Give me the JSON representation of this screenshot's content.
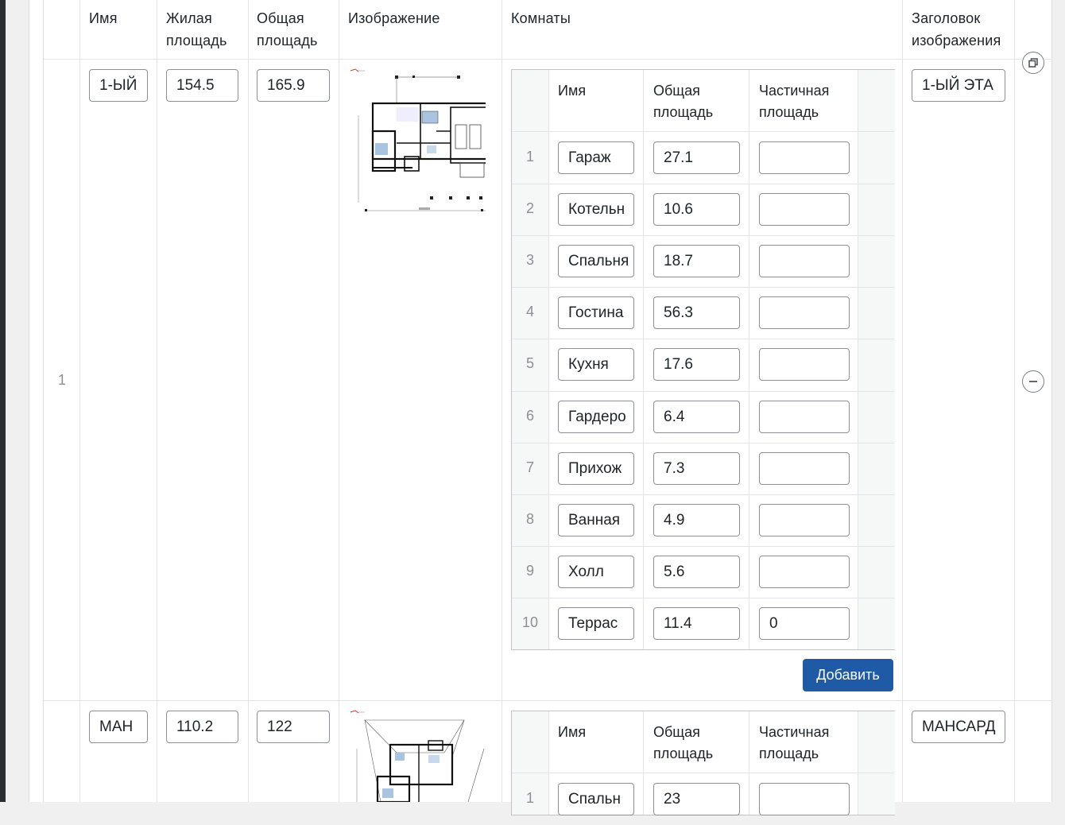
{
  "columns": {
    "name": "Имя",
    "living_area": [
      "Жилая",
      "площадь"
    ],
    "total_area": [
      "Общая",
      "площадь"
    ],
    "image": "Изображение",
    "rooms": "Комнаты",
    "image_title": [
      "Заголовок",
      "изображения"
    ]
  },
  "rooms_columns": {
    "name": "Имя",
    "total_area": [
      "Общая",
      "площадь"
    ],
    "partial_area": [
      "Частичная",
      "площадь"
    ]
  },
  "floors": [
    {
      "row_number": "1",
      "name": "1-ЫЙ",
      "living_area": "154.5",
      "total_area": "165.9",
      "image_title": "1-ЫЙ ЭТА",
      "rooms": [
        {
          "n": "1",
          "name": "Гараж",
          "area": "27.1",
          "partial": ""
        },
        {
          "n": "2",
          "name": "Котельн",
          "area": "10.6",
          "partial": ""
        },
        {
          "n": "3",
          "name": "Спальня",
          "area": "18.7",
          "partial": ""
        },
        {
          "n": "4",
          "name": "Гостина",
          "area": "56.3",
          "partial": ""
        },
        {
          "n": "5",
          "name": "Кухня",
          "area": "17.6",
          "partial": ""
        },
        {
          "n": "6",
          "name": "Гардеро",
          "area": "6.4",
          "partial": ""
        },
        {
          "n": "7",
          "name": "Прихож",
          "area": "7.3",
          "partial": ""
        },
        {
          "n": "8",
          "name": "Ванная",
          "area": "4.9",
          "partial": ""
        },
        {
          "n": "9",
          "name": "Холл",
          "area": "5.6",
          "partial": ""
        },
        {
          "n": "10",
          "name": "Террас",
          "area": "11.4",
          "partial": "0"
        }
      ],
      "add_button": "Добавить"
    },
    {
      "name": "МАН",
      "living_area": "110.2",
      "total_area": "122",
      "image_title": "МАНСАРД",
      "rooms": [
        {
          "n": "1",
          "name": "Спальн",
          "area": "23",
          "partial": ""
        }
      ]
    }
  ],
  "icons": {
    "duplicate": "duplicate-icon",
    "remove": "remove-row-icon"
  },
  "colors": {
    "primary_button": "#1f5aa6",
    "border": "#8c8f94",
    "background": "#f0f0f1"
  }
}
